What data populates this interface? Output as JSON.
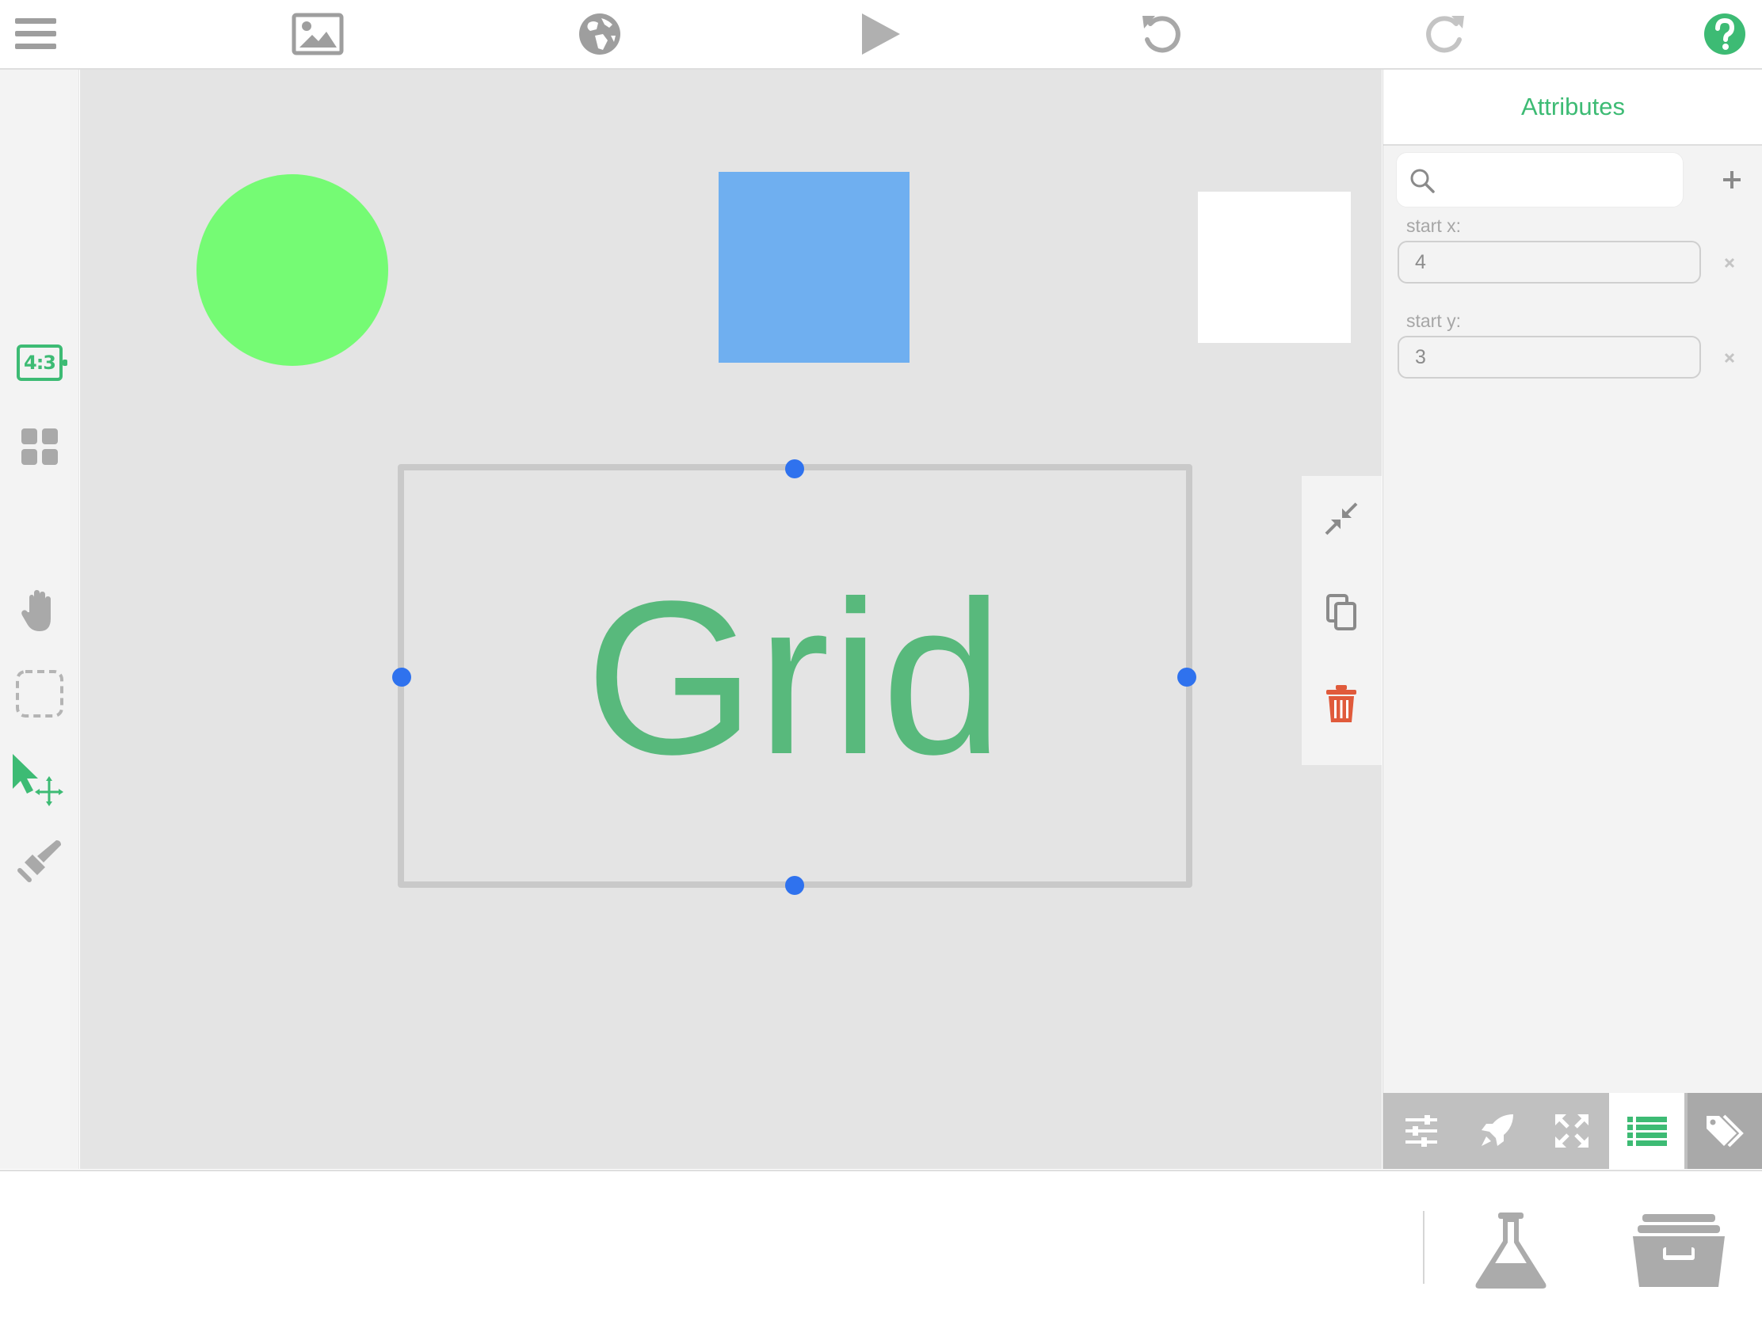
{
  "toolbar": {
    "icons": [
      "menu-icon",
      "image-icon",
      "globe-icon",
      "play-icon",
      "undo-icon",
      "redo-icon",
      "help-icon"
    ]
  },
  "sidebar": {
    "aspect_ratio": "4:3",
    "tools": [
      "aspect-ratio-icon",
      "grid-apps-icon",
      "hand-pan-icon",
      "selection-marquee-icon",
      "select-move-icon",
      "stamp-icon"
    ]
  },
  "canvas": {
    "grid_widget_label": "Grid",
    "shapes": [
      "circle",
      "square",
      "white-square"
    ]
  },
  "attributes_panel": {
    "title": "Attributes",
    "search": {
      "value": "",
      "placeholder": ""
    },
    "fields": [
      {
        "label": "start x:",
        "value": "4"
      },
      {
        "label": "start y:",
        "value": "3"
      }
    ],
    "tabs": [
      "sliders-icon",
      "rocket-icon",
      "expand-icon",
      "list-icon",
      "tags-icon"
    ],
    "active_tab": "list-icon"
  },
  "bottom": {
    "icons": [
      "flask-icon",
      "archive-icon"
    ]
  },
  "colors": {
    "accent": "#3dbb74",
    "circle": "#75fb74",
    "square": "#6faff0",
    "handle": "#2f72ee",
    "delete": "#e05a3b"
  }
}
